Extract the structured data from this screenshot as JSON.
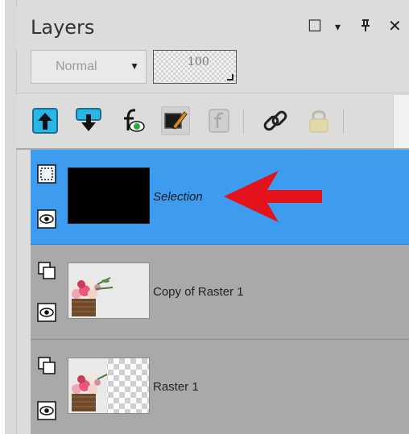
{
  "panel": {
    "title": "Layers",
    "title_buttons": [
      {
        "name": "maximize-icon",
        "glyph": "☐"
      },
      {
        "name": "dropdown-icon",
        "glyph": "▾"
      },
      {
        "name": "pin-icon",
        "glyph": "╡"
      },
      {
        "name": "close-icon",
        "glyph": "✕"
      }
    ]
  },
  "properties": {
    "blend_mode": "Normal",
    "opacity": "100"
  },
  "toolbar": {
    "icons": [
      "move-layer-up-icon",
      "move-layer-down-icon",
      "layer-properties-icon",
      "edit-selection-icon",
      "fx-effects-icon",
      "link-icon",
      "lock-icon"
    ]
  },
  "layers": [
    {
      "name": "Selection",
      "selected": true,
      "thumb": "black",
      "type_icon": "selection-layer-icon"
    },
    {
      "name": "Copy of Raster 1",
      "selected": false,
      "thumb": "flowers",
      "type_icon": "raster-layer-icon"
    },
    {
      "name": "Raster 1",
      "selected": false,
      "thumb": "flowers-transparent",
      "type_icon": "raster-layer-icon"
    }
  ],
  "colors": {
    "selected_row": "#3d9bf0",
    "row_bg": "#a9a9a9",
    "annotation_arrow": "#e3121b"
  }
}
